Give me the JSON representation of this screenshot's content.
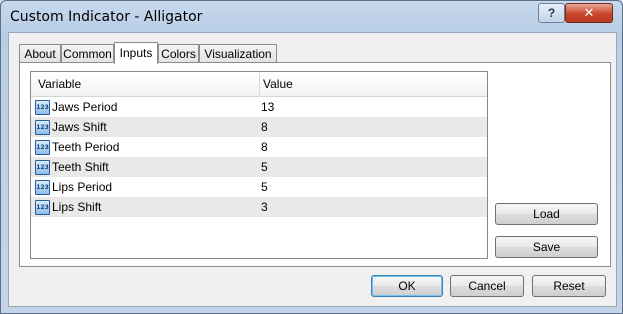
{
  "window": {
    "title": "Custom Indicator - Alligator",
    "help_label": "?",
    "close_label": "✕"
  },
  "tabs": [
    {
      "label": "About"
    },
    {
      "label": "Common"
    },
    {
      "label": "Inputs",
      "active": true
    },
    {
      "label": "Colors"
    },
    {
      "label": "Visualization"
    }
  ],
  "grid": {
    "columns": [
      "Variable",
      "Value"
    ],
    "icon_text": "123",
    "rows": [
      {
        "variable": "Jaws Period",
        "value": "13"
      },
      {
        "variable": "Jaws Shift",
        "value": "8"
      },
      {
        "variable": "Teeth Period",
        "value": "8"
      },
      {
        "variable": "Teeth Shift",
        "value": "5"
      },
      {
        "variable": "Lips Period",
        "value": "5"
      },
      {
        "variable": "Lips Shift",
        "value": "3"
      }
    ]
  },
  "side_buttons": {
    "load": "Load",
    "save": "Save"
  },
  "footer": {
    "ok": "OK",
    "cancel": "Cancel",
    "reset": "Reset"
  }
}
